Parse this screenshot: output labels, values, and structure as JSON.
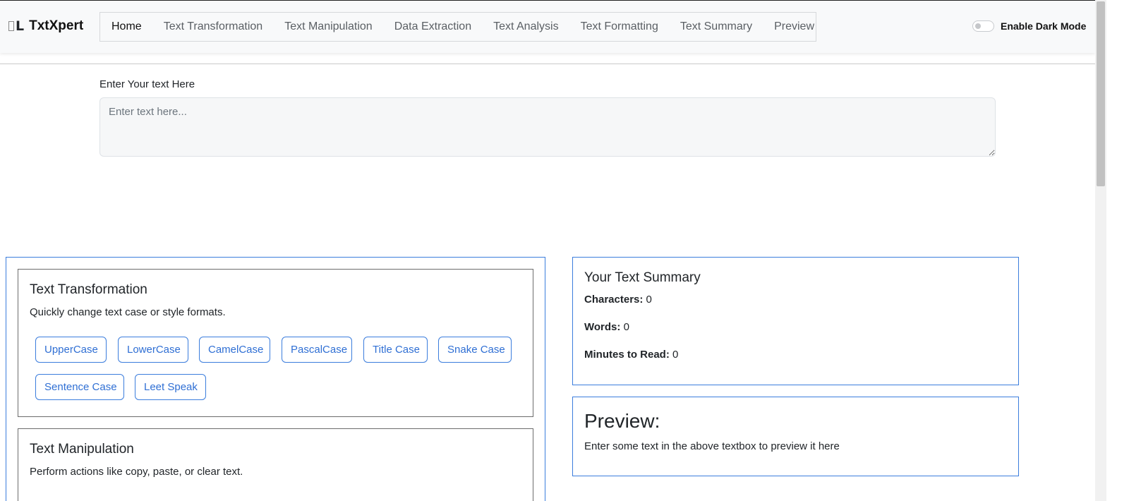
{
  "brand": {
    "img_alt": "L",
    "name": "TxtXpert"
  },
  "nav": {
    "items": [
      {
        "label": "Home",
        "active": true
      },
      {
        "label": "Text Transformation"
      },
      {
        "label": "Text Manipulation"
      },
      {
        "label": "Data Extraction"
      },
      {
        "label": "Text Analysis"
      },
      {
        "label": "Text Formatting"
      },
      {
        "label": "Text Summary"
      },
      {
        "label": "Preview"
      }
    ]
  },
  "darkmode": {
    "label": "Enable Dark Mode",
    "enabled": false
  },
  "input": {
    "label": "Enter Your text Here",
    "placeholder": "Enter text here...",
    "value": ""
  },
  "transformation": {
    "title": "Text Transformation",
    "description": "Quickly change text case or style formats.",
    "buttons": [
      "UpperCase",
      "LowerCase",
      "CamelCase",
      "PascalCase",
      "Title Case",
      "Snake Case",
      "Sentence Case",
      "Leet Speak"
    ]
  },
  "manipulation": {
    "title": "Text Manipulation",
    "description": "Perform actions like copy, paste, or clear text."
  },
  "summary": {
    "title": "Your Text Summary",
    "characters_label": "Characters:",
    "characters": "0",
    "words_label": "Words:",
    "words": "0",
    "minutes_label": "Minutes to Read:",
    "minutes": "0"
  },
  "preview": {
    "title": "Preview:",
    "text": "Enter some text in the above textbox to preview it here"
  },
  "colors": {
    "accent": "#3b7ddd",
    "navbar_bg": "#f8f9fa"
  }
}
